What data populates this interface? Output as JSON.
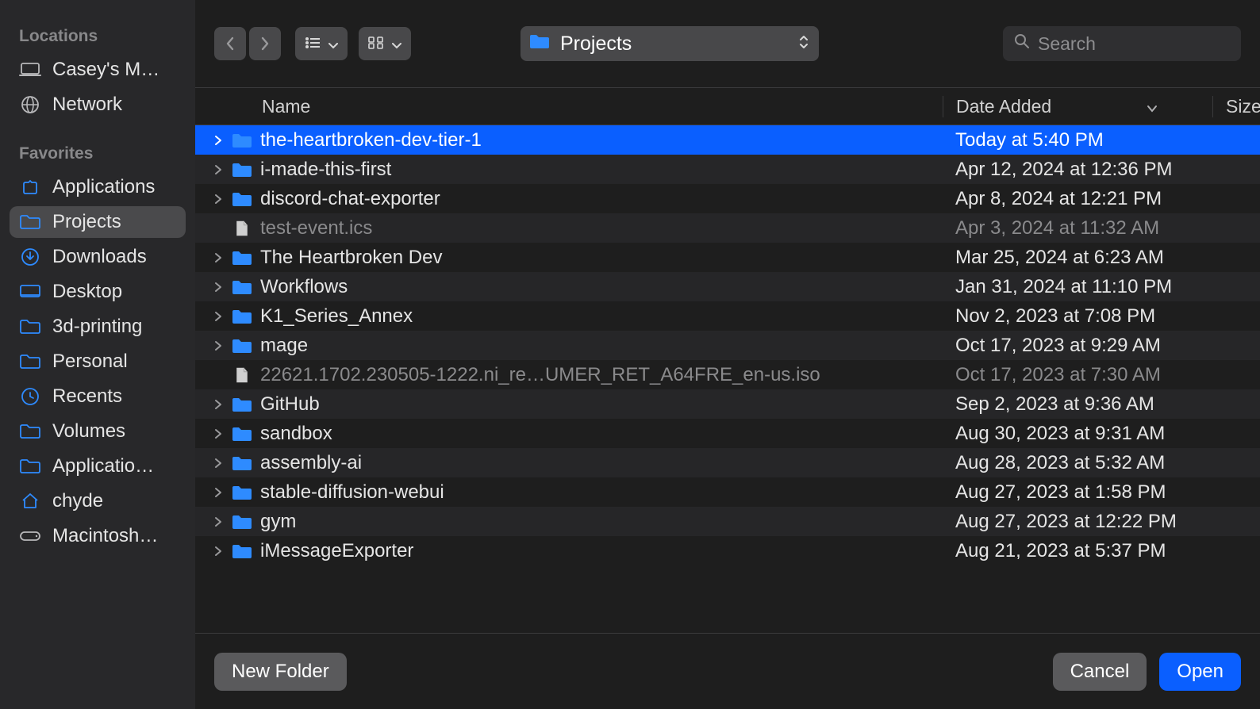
{
  "sidebar": {
    "sections": [
      {
        "header": "Locations",
        "items": [
          {
            "icon": "laptop",
            "label": "Casey's M…"
          },
          {
            "icon": "globe",
            "label": "Network"
          }
        ]
      },
      {
        "header": "Favorites",
        "items": [
          {
            "icon": "app",
            "label": "Applications"
          },
          {
            "icon": "folder",
            "label": "Projects",
            "selected": true
          },
          {
            "icon": "download",
            "label": "Downloads"
          },
          {
            "icon": "desktop",
            "label": "Desktop"
          },
          {
            "icon": "folder",
            "label": "3d-printing"
          },
          {
            "icon": "folder",
            "label": "Personal"
          },
          {
            "icon": "recents",
            "label": "Recents"
          },
          {
            "icon": "folder",
            "label": "Volumes"
          },
          {
            "icon": "folder",
            "label": "Applicatio…"
          },
          {
            "icon": "home",
            "label": "chyde"
          },
          {
            "icon": "disk",
            "label": "Macintosh…"
          }
        ]
      }
    ]
  },
  "toolbar": {
    "path_title": "Projects",
    "search_placeholder": "Search"
  },
  "columns": {
    "name": "Name",
    "date": "Date Added",
    "size": "Size"
  },
  "files": [
    {
      "kind": "folder",
      "name": "the-heartbroken-dev-tier-1",
      "date": "Today at 5:40 PM",
      "selected": true
    },
    {
      "kind": "folder",
      "name": "i-made-this-first",
      "date": "Apr 12, 2024 at 12:36 PM"
    },
    {
      "kind": "folder",
      "name": "discord-chat-exporter",
      "date": "Apr 8, 2024 at 12:21 PM"
    },
    {
      "kind": "file-ics",
      "name": "test-event.ics",
      "date": "Apr 3, 2024 at 11:32 AM",
      "dimmed": true,
      "no_chevron": true
    },
    {
      "kind": "folder",
      "name": "The Heartbroken Dev",
      "date": "Mar 25, 2024 at 6:23 AM"
    },
    {
      "kind": "folder",
      "name": "Workflows",
      "date": "Jan 31, 2024 at 11:10 PM"
    },
    {
      "kind": "folder",
      "name": "K1_Series_Annex",
      "date": "Nov 2, 2023 at 7:08 PM"
    },
    {
      "kind": "folder",
      "name": "mage",
      "date": "Oct 17, 2023 at 9:29 AM"
    },
    {
      "kind": "file-iso",
      "name": "22621.1702.230505-1222.ni_re…UMER_RET_A64FRE_en-us.iso",
      "date": "Oct 17, 2023 at 7:30 AM",
      "dimmed": true,
      "no_chevron": true
    },
    {
      "kind": "folder",
      "name": "GitHub",
      "date": "Sep 2, 2023 at 9:36 AM"
    },
    {
      "kind": "folder",
      "name": "sandbox",
      "date": "Aug 30, 2023 at 9:31 AM"
    },
    {
      "kind": "folder",
      "name": "assembly-ai",
      "date": "Aug 28, 2023 at 5:32 AM"
    },
    {
      "kind": "folder",
      "name": "stable-diffusion-webui",
      "date": "Aug 27, 2023 at 1:58 PM"
    },
    {
      "kind": "folder",
      "name": "gym",
      "date": "Aug 27, 2023 at 12:22 PM"
    },
    {
      "kind": "folder",
      "name": "iMessageExporter",
      "date": "Aug 21, 2023 at 5:37 PM"
    }
  ],
  "footer": {
    "new_folder": "New Folder",
    "cancel": "Cancel",
    "open": "Open"
  },
  "colors": {
    "accent": "#0a5fff",
    "folder": "#2e8bff",
    "icon_gray": "#b8b8ba"
  }
}
